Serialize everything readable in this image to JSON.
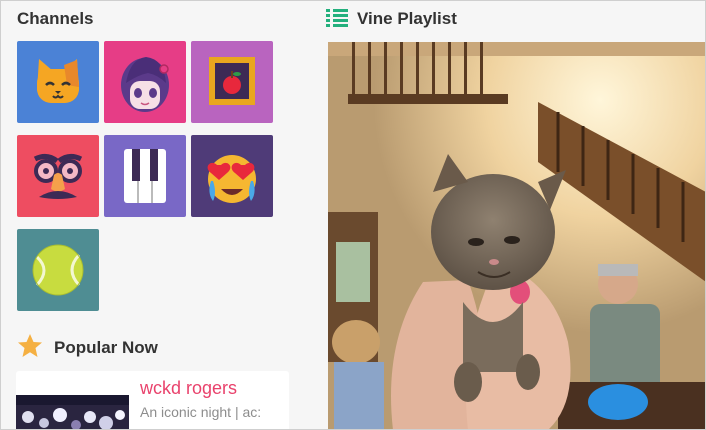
{
  "channels_section": {
    "title": "Channels",
    "items": [
      {
        "icon": "cat-icon",
        "color": "#4b82d6"
      },
      {
        "icon": "anime-girl-icon",
        "color": "#e63d86"
      },
      {
        "icon": "apple-painting-icon",
        "color": "#b964bf"
      },
      {
        "icon": "disguise-glasses-icon",
        "color": "#ee4d61"
      },
      {
        "icon": "piano-keys-icon",
        "color": "#7968c6"
      },
      {
        "icon": "heart-eyes-crying-emoji-icon",
        "color": "#4f3b78"
      },
      {
        "icon": "tennis-ball-icon",
        "color": "#4f8d93"
      }
    ]
  },
  "playlist": {
    "title": "Vine Playlist",
    "icon": "playlist-icon",
    "accent": "#23b07d"
  },
  "popular": {
    "title": "Popular Now",
    "icon": "star-icon",
    "card": {
      "title": "wckd rogers",
      "description": "An iconic night | ac:"
    }
  }
}
